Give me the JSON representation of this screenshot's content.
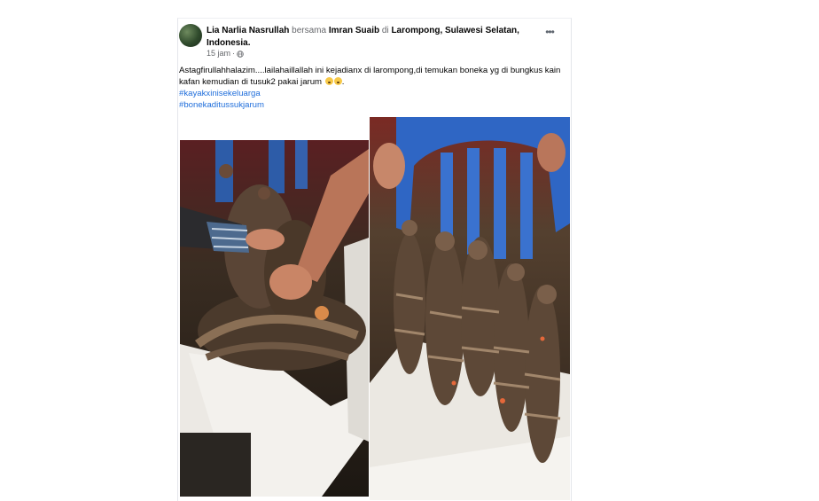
{
  "post": {
    "author": "Lia Narlia Nasrullah",
    "with_word": "bersama",
    "tagged": "Imran Suaib",
    "at_word": "di",
    "location": "Larompong, Sulawesi Selatan, Indonesia",
    "timestamp": "15 jam",
    "separator": "·",
    "more_label": "•••",
    "text": "Astagfirullahhalazim....lailahaillallah  ini kejadianx di larompong,di temukan boneka yg di bungkus kain kafan kemudian di tusuk2 pakai jarum",
    "hashtags": [
      "#kayakxinisekeluarga",
      "#bonekaditussukjarum"
    ]
  },
  "colors": {
    "name_text": "#050505",
    "secondary_text": "#65676b",
    "hashtag": "#216fdb"
  },
  "icons": {
    "privacy": "globe-icon",
    "emoji_1": "surprised-face-emoji",
    "emoji_2": "sad-face-emoji"
  },
  "photos": [
    {
      "description": "hands unwrapping cloth-wrapped dolls in cardboard box"
    },
    {
      "description": "many cloth-wrapped dolls held upright in front of blue plastic chair"
    }
  ]
}
